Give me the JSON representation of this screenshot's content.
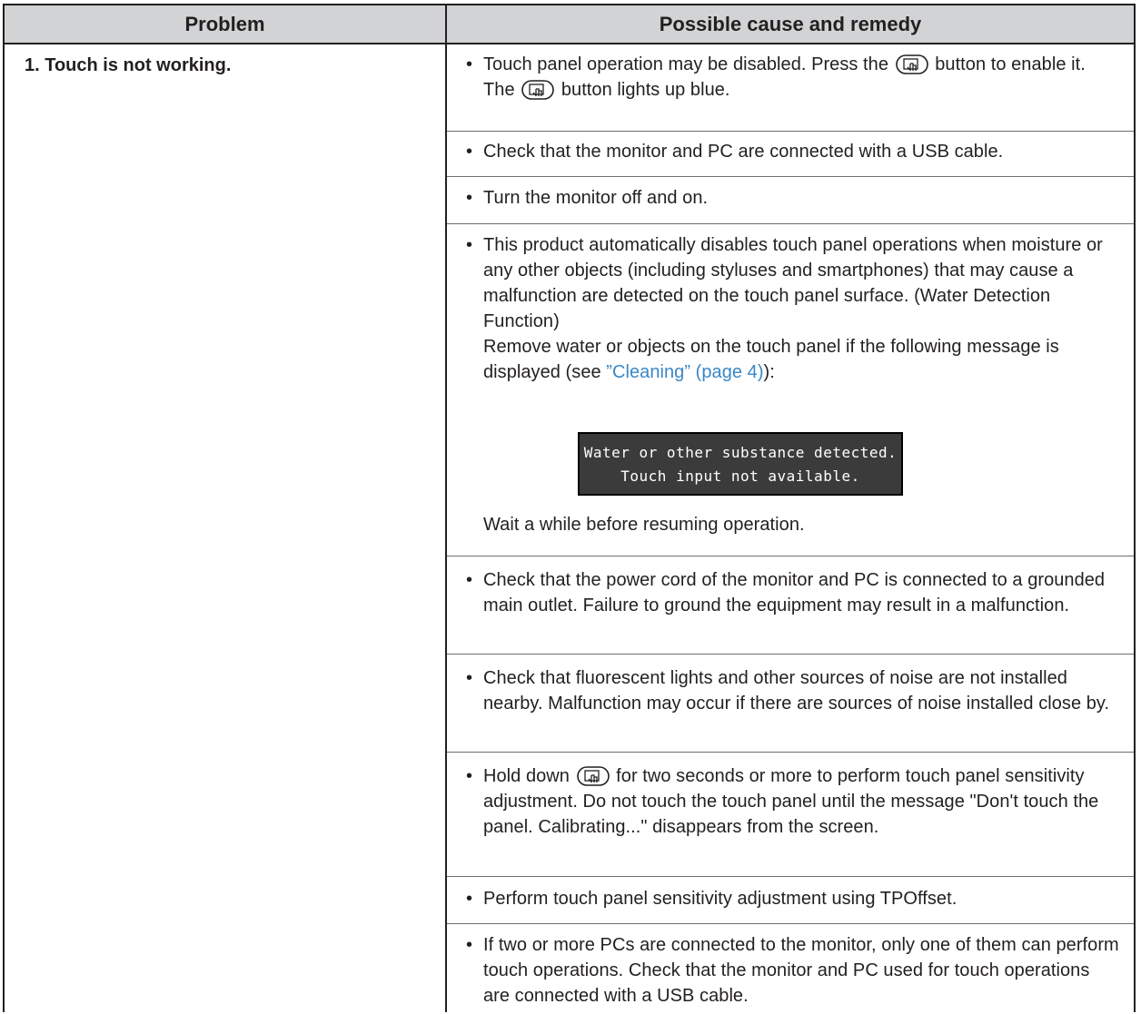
{
  "headers": {
    "problem": "Problem",
    "remedy": "Possible cause and remedy"
  },
  "problem": "1. Touch is not working.",
  "bullet": "•",
  "icon_name": "touch-button-icon",
  "remedies": {
    "r1": {
      "part1": "Touch panel operation may be disabled. Press the",
      "part2": "button to enable it. The",
      "part3": "button lights up blue."
    },
    "r2": "Check that the monitor and PC are connected with a USB cable.",
    "r3": "Turn the monitor off and on.",
    "r4": {
      "line1": "This product automatically disables touch panel operations when moisture or any other objects (including styluses and smartphones) that may cause a malfunction are detected on the touch panel surface. (Water Detection Function)",
      "line2": "Remove water or objects on the touch panel if the following message is displayed (see",
      "link": "”Cleaning” (page 4)",
      "line2_end": "):",
      "message_line1": "Water or other substance detected.",
      "message_line2": "Touch input not available.",
      "after": "Wait a while before resuming operation."
    },
    "r5": "Check that the power cord of the monitor and PC is connected to a grounded main outlet. Failure to ground the equipment may result in a malfunction.",
    "r6": "Check that fluorescent lights and other sources of noise are not installed nearby. Malfunction may occur if there are sources of noise installed close by.",
    "r7": {
      "part1": "Hold down",
      "part2": "for two seconds or more to perform touch panel sensitivity adjustment. Do not touch the touch panel until the message \"Don't touch the panel. Calibrating...\" disappears from the screen."
    },
    "r8": "Perform touch panel sensitivity adjustment using TPOffset.",
    "r9": "If two or more PCs are connected to the monitor, only one of them can perform touch operations. Check that the monitor and PC used for touch operations are connected with a USB cable."
  }
}
